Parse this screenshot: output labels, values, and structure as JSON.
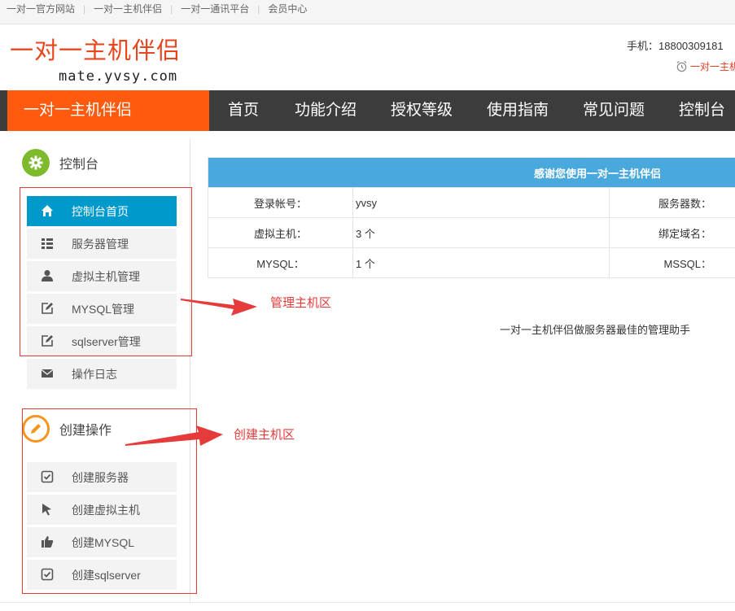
{
  "top_links": [
    "一对一官方网站",
    "一对一主机伴侣",
    "一对一通讯平台",
    "会员中心"
  ],
  "header": {
    "logo_title": "一对一主机伴侣",
    "logo_domain": "mate.yvsy.com",
    "phone_label": "手机：",
    "phone_number": "18800309181",
    "clock_text": "一对一主机"
  },
  "nav": {
    "brand": "一对一主机伴侣",
    "items": [
      "首页",
      "功能介绍",
      "授权等级",
      "使用指南",
      "常见问题",
      "控制台"
    ]
  },
  "sidebar": {
    "section1": {
      "title": "控制台",
      "icon": "gear-icon",
      "color": "#7dbb2c"
    },
    "menu1": [
      {
        "label": "控制台首页",
        "icon": "home-icon"
      },
      {
        "label": "服务器管理",
        "icon": "list-icon"
      },
      {
        "label": "虚拟主机管理",
        "icon": "user-icon"
      },
      {
        "label": "MYSQL管理",
        "icon": "edit-icon"
      },
      {
        "label": "sqlserver管理",
        "icon": "edit-icon"
      },
      {
        "label": "操作日志",
        "icon": "mail-icon"
      }
    ],
    "section2": {
      "title": "创建操作",
      "icon": "pencil-icon",
      "color": "#f7941d"
    },
    "menu2": [
      {
        "label": "创建服务器",
        "icon": "check-icon"
      },
      {
        "label": "创建虚拟主机",
        "icon": "cursor-icon"
      },
      {
        "label": "创建MYSQL",
        "icon": "thumbs-up-icon"
      },
      {
        "label": "创建sqlserver",
        "icon": "check-icon"
      }
    ]
  },
  "main": {
    "table_title": "感谢您使用一对一主机伴侣",
    "rows": [
      {
        "label": "登录帐号：",
        "value": "yvsy",
        "label2": "服务器数："
      },
      {
        "label": "虚拟主机：",
        "value": "3 个",
        "label2": "绑定域名："
      },
      {
        "label": "MYSQL：",
        "value": "1 个",
        "label2": "MSSQL："
      }
    ],
    "slogan": "一对一主机伴侣做服务器最佳的管理助手"
  },
  "annotations": {
    "manage_area": "管理主机区",
    "create_area": "创建主机区",
    "color": "#e63b3b"
  },
  "colors": {
    "brand_orange": "#ff5a0d",
    "nav_dark": "#3c3c3c",
    "active_blue": "#0099cc",
    "table_header": "#4aa9dc",
    "logo_red": "#e8461f"
  }
}
